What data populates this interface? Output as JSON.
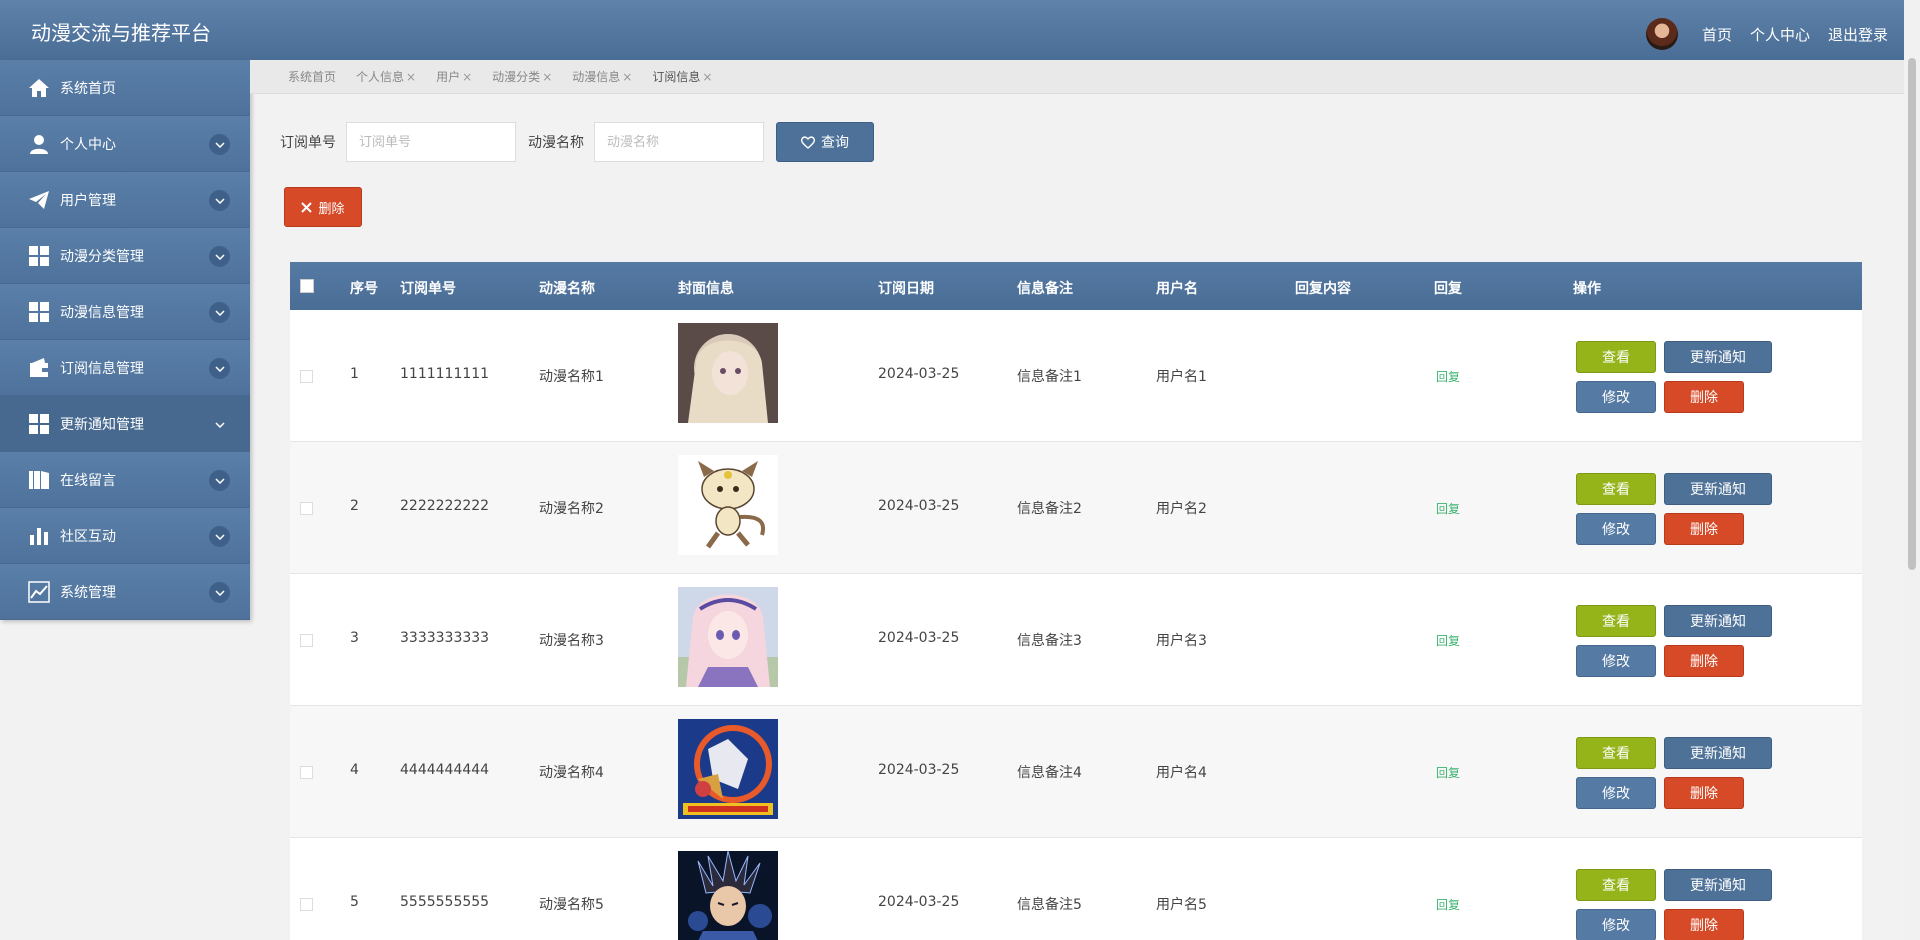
{
  "app": {
    "title": "动漫交流与推荐平台"
  },
  "header_nav": {
    "home": "首页",
    "profile": "个人中心",
    "logout": "退出登录"
  },
  "sidebar": {
    "items": [
      {
        "label": "系统首页",
        "icon": "home-icon",
        "chevron": false
      },
      {
        "label": "个人中心",
        "icon": "user-icon",
        "chevron": true
      },
      {
        "label": "用户管理",
        "icon": "paper-plane-icon",
        "chevron": true
      },
      {
        "label": "动漫分类管理",
        "icon": "grid-icon",
        "chevron": true
      },
      {
        "label": "动漫信息管理",
        "icon": "grid-icon",
        "chevron": true
      },
      {
        "label": "订阅信息管理",
        "icon": "wallet-icon",
        "chevron": true
      },
      {
        "label": "更新通知管理",
        "icon": "grid-icon",
        "chevron": true,
        "active": true
      },
      {
        "label": "在线留言",
        "icon": "book-icon",
        "chevron": true
      },
      {
        "label": "社区互动",
        "icon": "bar-chart-icon",
        "chevron": true
      },
      {
        "label": "系统管理",
        "icon": "line-chart-icon",
        "chevron": true
      }
    ]
  },
  "tabs": [
    {
      "label": "系统首页",
      "closable": false
    },
    {
      "label": "个人信息",
      "closable": true
    },
    {
      "label": "用户",
      "closable": true
    },
    {
      "label": "动漫分类",
      "closable": true
    },
    {
      "label": "动漫信息",
      "closable": true
    },
    {
      "label": "订阅信息",
      "closable": true,
      "active": true
    }
  ],
  "tab_close_glyph": "×",
  "search": {
    "order_label": "订阅单号",
    "order_placeholder": "订阅单号",
    "name_label": "动漫名称",
    "name_placeholder": "动漫名称",
    "button": "查询"
  },
  "batch_delete": "删除",
  "table": {
    "columns": [
      "序号",
      "订阅单号",
      "动漫名称",
      "封面信息",
      "订阅日期",
      "信息备注",
      "用户名",
      "回复内容",
      "回复",
      "操作"
    ],
    "rows": [
      {
        "index": "1",
        "order_no": "1111111111",
        "name": "动漫名称1",
        "cover": "cover-anime-1",
        "date": "2024-03-25",
        "note": "信息备注1",
        "user": "用户名1",
        "reply_content": "",
        "reply": "回复"
      },
      {
        "index": "2",
        "order_no": "2222222222",
        "name": "动漫名称2",
        "cover": "cover-anime-2",
        "date": "2024-03-25",
        "note": "信息备注2",
        "user": "用户名2",
        "reply_content": "",
        "reply": "回复"
      },
      {
        "index": "3",
        "order_no": "3333333333",
        "name": "动漫名称3",
        "cover": "cover-anime-3",
        "date": "2024-03-25",
        "note": "信息备注3",
        "user": "用户名3",
        "reply_content": "",
        "reply": "回复"
      },
      {
        "index": "4",
        "order_no": "4444444444",
        "name": "动漫名称4",
        "cover": "cover-anime-4",
        "date": "2024-03-25",
        "note": "信息备注4",
        "user": "用户名4",
        "reply_content": "",
        "reply": "回复"
      },
      {
        "index": "5",
        "order_no": "5555555555",
        "name": "动漫名称5",
        "cover": "cover-anime-5",
        "date": "2024-03-25",
        "note": "信息备注5",
        "user": "用户名5",
        "reply_content": "",
        "reply": "回复"
      }
    ],
    "actions": {
      "view": "查看",
      "notify": "更新通知",
      "edit": "修改",
      "delete": "删除"
    }
  },
  "colors": {
    "header": "#5a7ea8",
    "sidebar": "#557aa3",
    "primary_button": "#4d7198",
    "danger_button": "#d64a28",
    "view_button": "#94b41a",
    "reply_link": "#3cb371"
  }
}
